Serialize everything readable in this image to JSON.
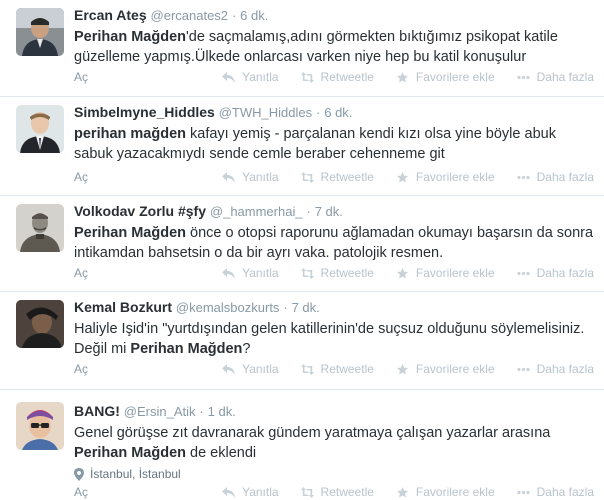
{
  "actions": {
    "expand": "Aç",
    "reply": "Yanıtla",
    "retweet": "Retweetle",
    "favorite": "Favorilere ekle",
    "more": "Daha fazla"
  },
  "tweets": [
    {
      "fullname": "Ercan Ateş",
      "username": "@ercanates2",
      "sep": "·",
      "time": "6 dk.",
      "text_parts": [
        {
          "bold": true,
          "t": "Perihan Mağden"
        },
        {
          "bold": false,
          "t": "'de saçmalamış,adını görmekten bıktığımız psikopat katile güzelleme yapmış.Ülkede onlarcası varken niye hep bu katil konuşulur"
        }
      ]
    },
    {
      "fullname": "Simbelmyne_Hiddles",
      "username": "@TWH_Hiddles",
      "sep": "·",
      "time": "6 dk.",
      "text_parts": [
        {
          "bold": true,
          "t": "perihan mağden"
        },
        {
          "bold": false,
          "t": " kafayı yemiş - parçalanan  kendi kızı olsa yine böyle abuk sabuk yazacakmıydı sende cemle beraber cehenneme git"
        }
      ]
    },
    {
      "fullname": "Volkodav Zorlu #şfy",
      "username": "@_hammerhai_",
      "sep": "·",
      "time": "7 dk.",
      "text_parts": [
        {
          "bold": true,
          "t": "Perihan Mağden"
        },
        {
          "bold": false,
          "t": " önce o otopsi raporunu ağlamadan okumayı başarsın da sonra intikamdan bahsetsin o da bir ayrı vaka. patolojik resmen."
        }
      ]
    },
    {
      "fullname": "Kemal Bozkurt",
      "username": "@kemalsbozkurts",
      "sep": "·",
      "time": "7 dk.",
      "text_parts": [
        {
          "bold": false,
          "t": "Haliyle Işid'in \"yurtdışından gelen katillerinin'de suçsuz olduğunu söylemelisiniz. Değil mi "
        },
        {
          "bold": true,
          "t": "Perihan Mağden"
        },
        {
          "bold": false,
          "t": "?"
        }
      ]
    },
    {
      "fullname": "BANG!",
      "username": "@Ersin_Atik",
      "sep": "·",
      "time": "1 dk.",
      "text_parts": [
        {
          "bold": false,
          "t": "Genel görüşse zıt davranarak gündem yaratmaya çalışan yazarlar arasına "
        },
        {
          "bold": true,
          "t": "Perihan Mağden"
        },
        {
          "bold": false,
          "t": " de eklendi"
        }
      ],
      "location": "İstanbul, İstanbul"
    }
  ],
  "colors": {
    "text": "#292f33",
    "meta": "#8899a6",
    "action": "#b8c3cc",
    "divider": "#e1e8ed"
  },
  "icons": [
    "reply-icon",
    "retweet-icon",
    "favorite-star-icon",
    "more-dots-icon",
    "location-pin-icon"
  ]
}
